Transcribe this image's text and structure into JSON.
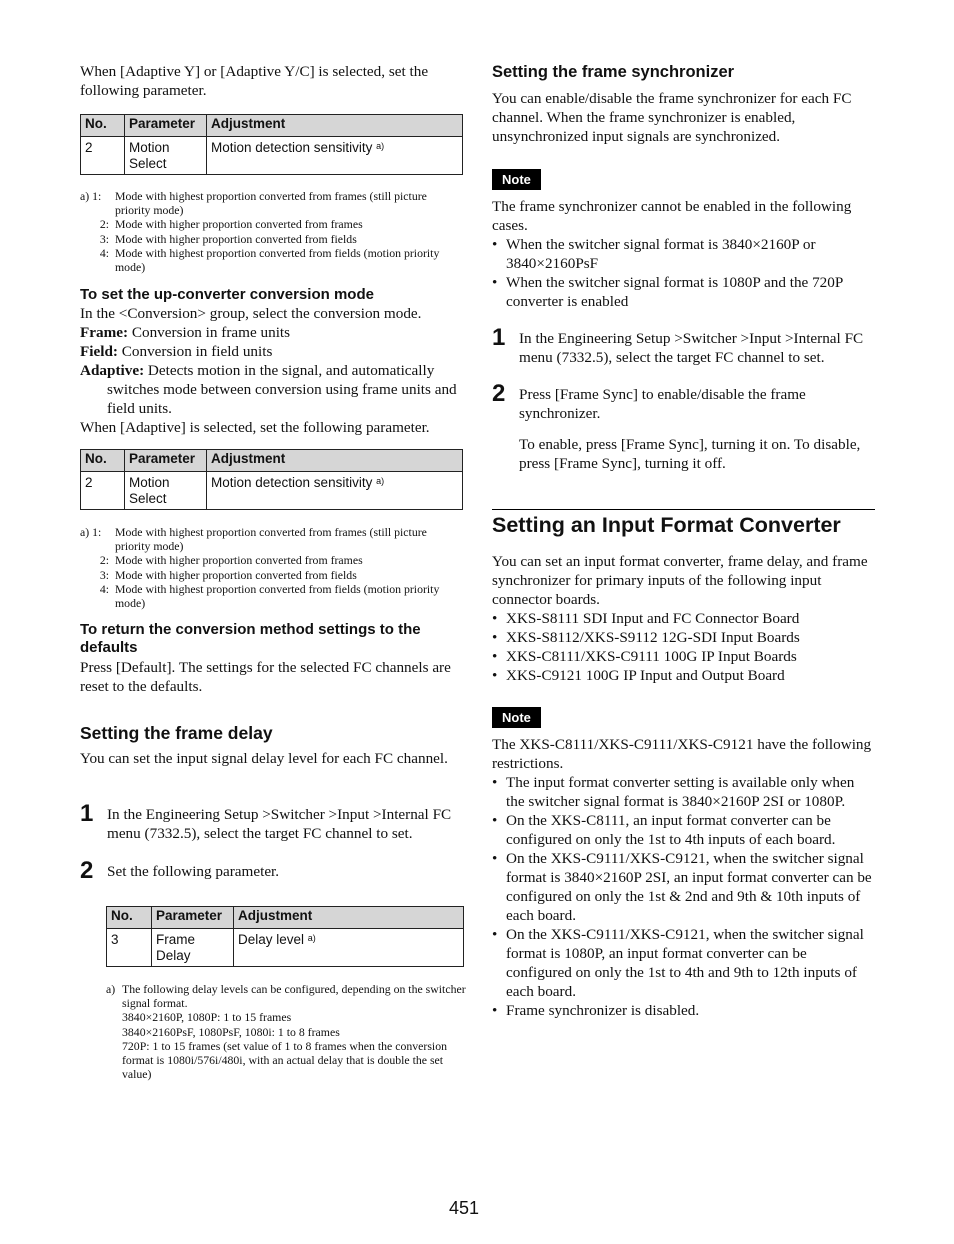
{
  "left": {
    "intro1": "When [Adaptive Y] or [Adaptive Y/C] is selected, set the following parameter.",
    "table1": {
      "headers": [
        "No.",
        "Parameter",
        "Adjustment"
      ],
      "rows": [
        {
          "no": "2",
          "parameter_line1": "Motion",
          "parameter_line2": "Select",
          "adjustment": "Motion detection sensitivity",
          "footnote_ref": "a)"
        }
      ]
    },
    "footnote1": {
      "label": "a)",
      "items": [
        {
          "key": "1:",
          "text": "Mode with highest proportion converted from frames (still picture priority mode)"
        },
        {
          "key": "2:",
          "text": "Mode with higher proportion converted from frames"
        },
        {
          "key": "3:",
          "text": "Mode with higher proportion converted from fields"
        },
        {
          "key": "4:",
          "text": "Mode with highest proportion converted from fields (motion priority mode)"
        }
      ]
    },
    "upconv": {
      "heading": "To set the up-converter conversion mode",
      "intro": "In the <Conversion> group, select the conversion mode.",
      "defs": [
        {
          "term": "Frame:",
          "desc": " Conversion in frame units"
        },
        {
          "term": "Field:",
          "desc": " Conversion in field units"
        },
        {
          "term": "Adaptive:",
          "desc": " Detects motion in the signal, and automatically switches mode between conversion using frame units and field units."
        }
      ],
      "outro": "When [Adaptive] is selected, set the following parameter."
    },
    "table2": {
      "headers": [
        "No.",
        "Parameter",
        "Adjustment"
      ],
      "rows": [
        {
          "no": "2",
          "parameter_line1": "Motion",
          "parameter_line2": "Select",
          "adjustment": "Motion detection sensitivity",
          "footnote_ref": "a)"
        }
      ]
    },
    "footnote2": {
      "label": "a)",
      "items": [
        {
          "key": "1:",
          "text": "Mode with highest proportion converted from frames (still picture priority mode)"
        },
        {
          "key": "2:",
          "text": "Mode with higher proportion converted from frames"
        },
        {
          "key": "3:",
          "text": "Mode with higher proportion converted from fields"
        },
        {
          "key": "4:",
          "text": "Mode with highest proportion converted from fields (motion priority mode)"
        }
      ]
    },
    "defaults": {
      "heading": "To return the conversion method settings to the defaults",
      "body": "Press [Default]. The settings for the selected FC channels are reset to the defaults."
    },
    "frame_delay": {
      "heading": "Setting the frame delay",
      "intro": "You can set the input signal delay level for each FC channel.",
      "steps": [
        {
          "num": "1",
          "text": "In the Engineering Setup >Switcher >Input >Internal FC menu (7332.5), select the target FC channel to set."
        },
        {
          "num": "2",
          "text": "Set the following parameter."
        }
      ],
      "table": {
        "headers": [
          "No.",
          "Parameter",
          "Adjustment"
        ],
        "rows": [
          {
            "no": "3",
            "parameter_line1": "Frame",
            "parameter_line2": "Delay",
            "adjustment": "Delay level",
            "footnote_ref": "a)"
          }
        ]
      },
      "footnote": {
        "label": "a)",
        "lines": [
          "The following delay levels can be configured, depending on the switcher signal format.",
          "3840×2160P, 1080P: 1 to 15 frames",
          "3840×2160PsF, 1080PsF, 1080i: 1 to 8 frames",
          "720P: 1 to 15 frames (set value of 1 to 8 frames when the conversion format is 1080i/576i/480i, with an actual delay that is double the set value)"
        ]
      }
    }
  },
  "right": {
    "frame_sync": {
      "heading": "Setting the frame synchronizer",
      "intro": "You can enable/disable the frame synchronizer for each FC channel. When the frame synchronizer is enabled, unsynchronized input signals are synchronized.",
      "note_label": "Note",
      "note_text": "The frame synchronizer cannot be enabled in the following cases.",
      "note_bullets": [
        "When the switcher signal format is 3840×2160P or 3840×2160PsF",
        "When the switcher signal format is 1080P and the 720P converter is enabled"
      ],
      "steps": [
        {
          "num": "1",
          "text": "In the Engineering Setup >Switcher >Input >Internal FC menu (7332.5), select the target FC channel to set."
        },
        {
          "num": "2",
          "text": "Press [Frame Sync] to enable/disable the frame synchronizer.",
          "extra": "To enable, press [Frame Sync], turning it on. To disable, press [Frame Sync], turning it off."
        }
      ]
    },
    "ifc": {
      "heading": "Setting an Input Format Converter",
      "intro": "You can set an input format converter, frame delay, and frame synchronizer for primary inputs of the following input connector boards.",
      "boards": [
        "XKS-S8111 SDI Input and FC Connector Board",
        "XKS-S8112/XKS-S9112 12G-SDI Input Boards",
        "XKS-C8111/XKS-C9111 100G IP Input Boards",
        "XKS-C9121 100G IP Input and Output Board"
      ],
      "note_label": "Note",
      "note_text": "The XKS-C8111/XKS-C9111/XKS-C9121 have the following restrictions.",
      "note_bullets": [
        "The input format converter setting is available only when the switcher signal format is 3840×2160P 2SI or 1080P.",
        "On the XKS-C8111, an input format converter can be configured on only the 1st to 4th inputs of each board.",
        "On the XKS-C9111/XKS-C9121, when the switcher signal format is 3840×2160P 2SI, an input format converter can be configured on only the 1st & 2nd and 9th & 10th inputs of each board.",
        "On the XKS-C9111/XKS-C9121, when the switcher signal format is 1080P, an input format converter can be configured on only the 1st to 4th and 9th to 12th inputs of each board.",
        "Frame synchronizer is disabled."
      ]
    }
  },
  "page_number": "451"
}
